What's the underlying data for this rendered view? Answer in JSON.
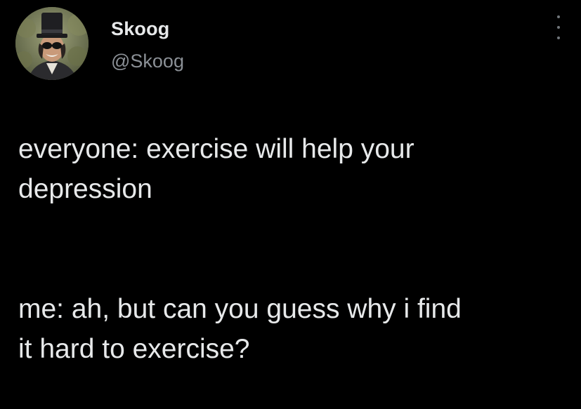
{
  "tweet": {
    "author": {
      "display_name": "Skoog",
      "handle": "@Skoog",
      "avatar_icon": "profile-photo-top-hat-sunglasses"
    },
    "more_icon": "vertical-ellipsis-icon",
    "paragraphs": [
      "everyone: exercise will help your\ndepression",
      "me: ah, but can you guess why i find\nit hard to exercise?"
    ]
  },
  "colors": {
    "background": "#000000",
    "primary_text": "#e7e9ea",
    "secondary_text": "#8b9096"
  }
}
